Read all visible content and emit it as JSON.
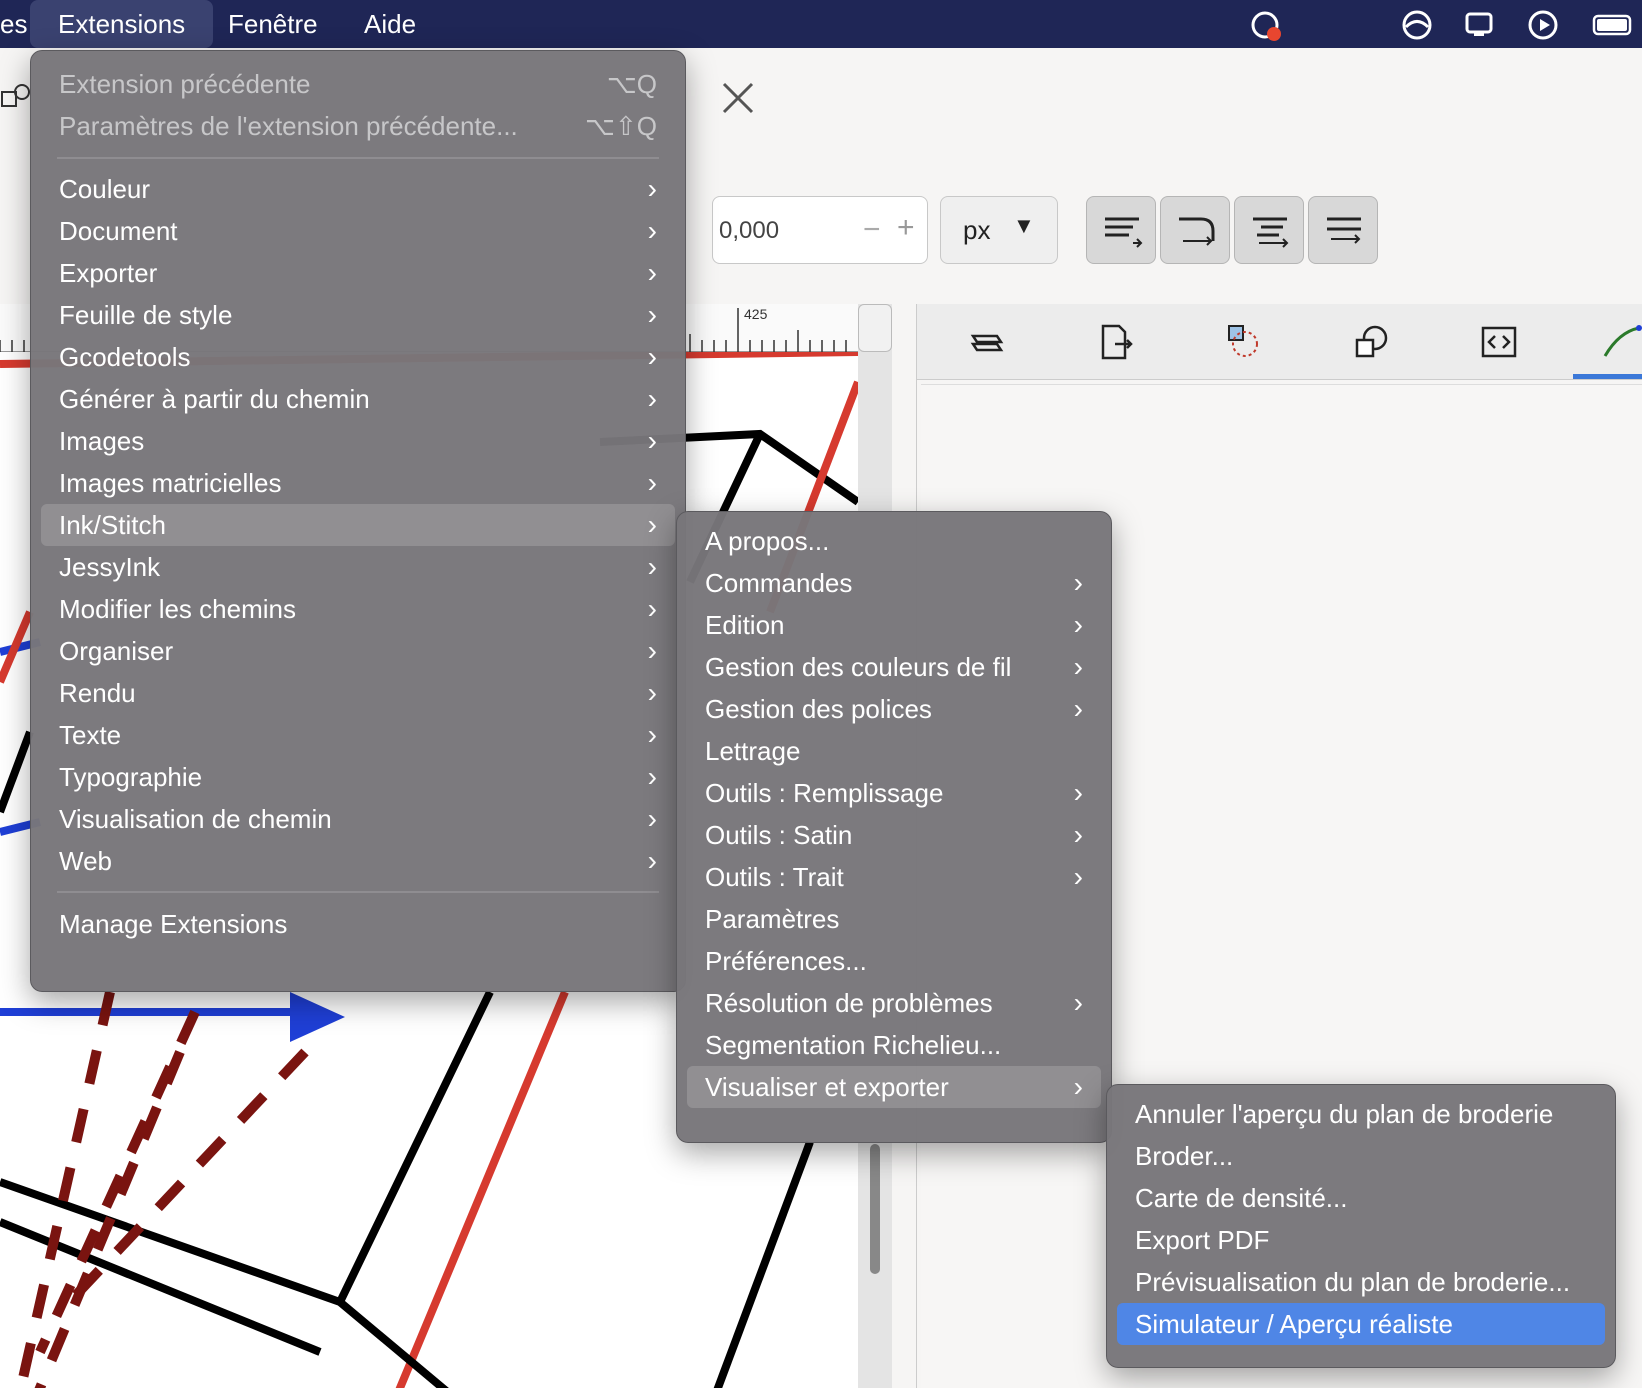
{
  "menubar": {
    "items": [
      "es",
      "Extensions",
      "Fenêtre",
      "Aide"
    ]
  },
  "toolbar": {
    "spin_value": "0,000",
    "unit": "px",
    "ruler_label": "425"
  },
  "extensions_menu": {
    "top": [
      {
        "label": "Extension précédente",
        "shortcut": "⌥Q",
        "disabled": true
      },
      {
        "label": "Paramètres de l'extension précédente...",
        "shortcut": "⌥⇧Q",
        "disabled": true
      }
    ],
    "items": [
      "Couleur",
      "Document",
      "Exporter",
      "Feuille de style",
      "Gcodetools",
      "Générer à partir du chemin",
      "Images",
      "Images matricielles",
      "Ink/Stitch",
      "JessyInk",
      "Modifier les chemins",
      "Organiser",
      "Rendu",
      "Texte",
      "Typographie",
      "Visualisation de chemin",
      "Web"
    ],
    "manage": "Manage Extensions"
  },
  "inkstitch_menu": {
    "items": [
      {
        "label": "A propos...",
        "sub": false
      },
      {
        "label": "Commandes",
        "sub": true
      },
      {
        "label": "Edition",
        "sub": true
      },
      {
        "label": "Gestion des couleurs de fil",
        "sub": true
      },
      {
        "label": "Gestion des polices",
        "sub": true
      },
      {
        "label": "Lettrage",
        "sub": false
      },
      {
        "label": "Outils : Remplissage",
        "sub": true
      },
      {
        "label": "Outils : Satin",
        "sub": true
      },
      {
        "label": "Outils : Trait",
        "sub": true
      },
      {
        "label": "Paramètres",
        "sub": false
      },
      {
        "label": "Préférences...",
        "sub": false
      },
      {
        "label": "Résolution de problèmes",
        "sub": true
      },
      {
        "label": "Segmentation Richelieu...",
        "sub": false
      },
      {
        "label": "Visualiser et exporter",
        "sub": true
      }
    ]
  },
  "visualize_menu": {
    "items": [
      "Annuler l'aperçu du plan de broderie",
      "Broder...",
      "Carte de densité...",
      "Export PDF",
      "Prévisualisation du plan de broderie...",
      "Simulateur / Aperçu réaliste"
    ]
  },
  "colors": {
    "menubar": "#1f2656",
    "menu_bg": "#78767a",
    "selection": "#4f86e6",
    "accent_red": "#d63a2f",
    "accent_blue": "#1f3fd6"
  }
}
